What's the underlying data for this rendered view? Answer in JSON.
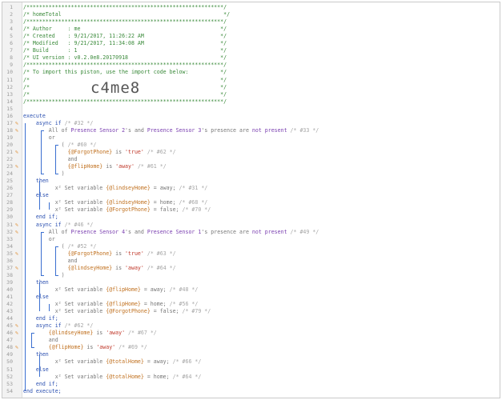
{
  "editor": {
    "header_code": "c4me8",
    "lines": [
      {
        "n": "1",
        "t": [
          [
            "/**************************************************************/",
            "g"
          ]
        ]
      },
      {
        "n": "2",
        "t": [
          [
            "/* homeTotal                                                   */",
            "g"
          ]
        ]
      },
      {
        "n": "3",
        "t": [
          [
            "/**************************************************************/",
            "g"
          ]
        ]
      },
      {
        "n": "4",
        "t": [
          [
            "/* Author     : me                                            */",
            "g"
          ]
        ]
      },
      {
        "n": "5",
        "t": [
          [
            "/* Created    : 9/21/2017, 11:26:22 AM                        */",
            "g"
          ]
        ]
      },
      {
        "n": "6",
        "t": [
          [
            "/* Modified   : 9/21/2017, 11:34:08 AM                        */",
            "g"
          ]
        ]
      },
      {
        "n": "7",
        "t": [
          [
            "/* Build      : 1                                             */",
            "g"
          ]
        ]
      },
      {
        "n": "8",
        "t": [
          [
            "/* UI version : v0.2.0e8.20170918                             */",
            "g"
          ]
        ]
      },
      {
        "n": "9",
        "t": [
          [
            "/**************************************************************/",
            "g"
          ]
        ]
      },
      {
        "n": "10",
        "t": [
          [
            "/* To import this piston, use the import code below:          */",
            "g"
          ]
        ]
      },
      {
        "n": "11",
        "t": [
          [
            "/*                                                            */",
            "g"
          ]
        ]
      },
      {
        "n": "12",
        "t": [
          [
            "/*                                                            */",
            "g"
          ]
        ]
      },
      {
        "n": "13",
        "t": [
          [
            "/*                                                            */",
            "g"
          ]
        ]
      },
      {
        "n": "14",
        "t": [
          [
            "/**************************************************************/",
            "g"
          ]
        ]
      },
      {
        "n": "15",
        "t": []
      },
      {
        "n": "16",
        "t": [
          [
            "execute",
            "k"
          ]
        ]
      },
      {
        "n": "17",
        "m": "✎",
        "t": [
          [
            "    async if ",
            "k"
          ],
          [
            "/* #32 */",
            "c"
          ]
        ]
      },
      {
        "n": "18",
        "m": "✎",
        "t": [
          [
            "        All of ",
            "n"
          ],
          [
            "Presence Sensor 2",
            "d"
          ],
          [
            "'s and ",
            "n"
          ],
          [
            "Presence Sensor 3",
            "d"
          ],
          [
            "'s ",
            "n"
          ],
          [
            "presence",
            "n"
          ],
          [
            " are ",
            "n"
          ],
          [
            "not present",
            "d"
          ],
          [
            " /* #33 */",
            "c"
          ]
        ]
      },
      {
        "n": "19",
        "t": [
          [
            "        or",
            "n"
          ]
        ]
      },
      {
        "n": "20",
        "t": [
          [
            "            ( ",
            "n"
          ],
          [
            "/* #60 */",
            "c"
          ]
        ]
      },
      {
        "n": "21",
        "m": "✎",
        "t": [
          [
            "              {@ForgotPhone}",
            "v"
          ],
          [
            " is ",
            "n"
          ],
          [
            "'true'",
            "s"
          ],
          [
            " /* #62 */",
            "c"
          ]
        ]
      },
      {
        "n": "22",
        "t": [
          [
            "              and",
            "n"
          ]
        ]
      },
      {
        "n": "23",
        "m": "✎",
        "t": [
          [
            "              {@flipHome}",
            "v"
          ],
          [
            " is ",
            "n"
          ],
          [
            "'away'",
            "s"
          ],
          [
            " /* #61 */",
            "c"
          ]
        ]
      },
      {
        "n": "24",
        "t": [
          [
            "            )",
            "n"
          ]
        ]
      },
      {
        "n": "25",
        "t": [
          [
            "    then",
            "k"
          ]
        ]
      },
      {
        "n": "26",
        "t": [
          [
            "          x² Set variable ",
            "n"
          ],
          [
            "{@lindseyHome}",
            "v"
          ],
          [
            " = away; ",
            "n"
          ],
          [
            "/* #31 */",
            "c"
          ]
        ]
      },
      {
        "n": "27",
        "t": [
          [
            "    else",
            "k"
          ]
        ]
      },
      {
        "n": "28",
        "t": [
          [
            "          x² Set variable ",
            "n"
          ],
          [
            "{@lindseyHome}",
            "v"
          ],
          [
            " = home; ",
            "n"
          ],
          [
            "/* #68 */",
            "c"
          ]
        ]
      },
      {
        "n": "29",
        "t": [
          [
            "          x² Set variable ",
            "n"
          ],
          [
            "{@ForgotPhone}",
            "v"
          ],
          [
            " = false; ",
            "n"
          ],
          [
            "/* #70 */",
            "c"
          ]
        ]
      },
      {
        "n": "30",
        "t": [
          [
            "    end if;",
            "k"
          ]
        ]
      },
      {
        "n": "31",
        "m": "✎",
        "t": [
          [
            "    async if ",
            "k"
          ],
          [
            "/* #46 */",
            "c"
          ]
        ]
      },
      {
        "n": "32",
        "m": "✎",
        "t": [
          [
            "        All of ",
            "n"
          ],
          [
            "Presence Sensor 4",
            "d"
          ],
          [
            "'s and ",
            "n"
          ],
          [
            "Presence Sensor 1",
            "d"
          ],
          [
            "'s ",
            "n"
          ],
          [
            "presence",
            "n"
          ],
          [
            " are ",
            "n"
          ],
          [
            "not present",
            "d"
          ],
          [
            " /* #49 */",
            "c"
          ]
        ]
      },
      {
        "n": "33",
        "t": [
          [
            "        or",
            "n"
          ]
        ]
      },
      {
        "n": "34",
        "t": [
          [
            "            ( ",
            "n"
          ],
          [
            "/* #52 */",
            "c"
          ]
        ]
      },
      {
        "n": "35",
        "m": "✎",
        "t": [
          [
            "              {@ForgotPhone}",
            "v"
          ],
          [
            " is ",
            "n"
          ],
          [
            "'true'",
            "s"
          ],
          [
            " /* #63 */",
            "c"
          ]
        ]
      },
      {
        "n": "36",
        "t": [
          [
            "              and",
            "n"
          ]
        ]
      },
      {
        "n": "37",
        "m": "✎",
        "t": [
          [
            "              {@lindseyHome}",
            "v"
          ],
          [
            " is ",
            "n"
          ],
          [
            "'away'",
            "s"
          ],
          [
            " /* #64 */",
            "c"
          ]
        ]
      },
      {
        "n": "38",
        "t": [
          [
            "            )",
            "n"
          ]
        ]
      },
      {
        "n": "39",
        "t": [
          [
            "    then",
            "k"
          ]
        ]
      },
      {
        "n": "40",
        "t": [
          [
            "          x² Set variable ",
            "n"
          ],
          [
            "{@flipHome}",
            "v"
          ],
          [
            " = away; ",
            "n"
          ],
          [
            "/* #48 */",
            "c"
          ]
        ]
      },
      {
        "n": "41",
        "t": [
          [
            "    else",
            "k"
          ]
        ]
      },
      {
        "n": "42",
        "t": [
          [
            "          x² Set variable ",
            "n"
          ],
          [
            "{@flipHome}",
            "v"
          ],
          [
            " = home; ",
            "n"
          ],
          [
            "/* #56 */",
            "c"
          ]
        ]
      },
      {
        "n": "43",
        "t": [
          [
            "          x² Set variable ",
            "n"
          ],
          [
            "{@ForgotPhone}",
            "v"
          ],
          [
            " = false; ",
            "n"
          ],
          [
            "/* #79 */",
            "c"
          ]
        ]
      },
      {
        "n": "44",
        "t": [
          [
            "    end if;",
            "k"
          ]
        ]
      },
      {
        "n": "45",
        "m": "✎",
        "t": [
          [
            "    async if ",
            "k"
          ],
          [
            "/* #62 */",
            "c"
          ]
        ]
      },
      {
        "n": "46",
        "m": "✎",
        "t": [
          [
            "        {@lindseyHome}",
            "v"
          ],
          [
            " is ",
            "n"
          ],
          [
            "'away'",
            "s"
          ],
          [
            " /* #67 */",
            "c"
          ]
        ]
      },
      {
        "n": "47",
        "t": [
          [
            "        and",
            "n"
          ]
        ]
      },
      {
        "n": "48",
        "m": "✎",
        "t": [
          [
            "        {@flipHome}",
            "v"
          ],
          [
            " is ",
            "n"
          ],
          [
            "'away'",
            "s"
          ],
          [
            " /* #69 */",
            "c"
          ]
        ]
      },
      {
        "n": "49",
        "t": [
          [
            "    then",
            "k"
          ]
        ]
      },
      {
        "n": "50",
        "t": [
          [
            "          x² Set variable ",
            "n"
          ],
          [
            "{@totalHome}",
            "v"
          ],
          [
            " = away; ",
            "n"
          ],
          [
            "/* #66 */",
            "c"
          ]
        ]
      },
      {
        "n": "51",
        "t": [
          [
            "    else",
            "k"
          ]
        ]
      },
      {
        "n": "52",
        "t": [
          [
            "          x² Set variable ",
            "n"
          ],
          [
            "{@totalHome}",
            "v"
          ],
          [
            " = home; ",
            "n"
          ],
          [
            "/* #64 */",
            "c"
          ]
        ]
      },
      {
        "n": "53",
        "t": [
          [
            "    end if;",
            "k"
          ]
        ]
      },
      {
        "n": "54",
        "t": [
          [
            "end execute;",
            "k"
          ]
        ]
      }
    ]
  },
  "colors": {
    "comment_header": "#3a8a3a",
    "keyword": "#2a4fb0",
    "device": "#7a3fb0",
    "variable": "#c0701e",
    "string": "#c0392b",
    "bracket": "#3a6fd0"
  },
  "icons": {
    "edit_marker": "pencil-icon"
  }
}
